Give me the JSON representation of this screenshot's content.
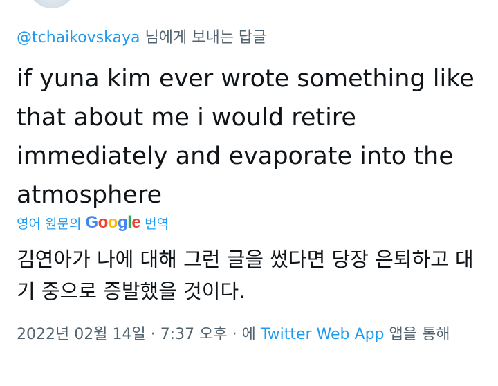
{
  "reply": {
    "handle": "@tchaikovskaya",
    "suffix": "님에게 보내는 답글"
  },
  "tweet": {
    "text": "if yuna kim ever wrote something like that about me i would retire immediately and evaporate into the atmosphere"
  },
  "translation": {
    "prefix": "영어 원문의",
    "logo": [
      "G",
      "o",
      "o",
      "g",
      "l",
      "e"
    ],
    "suffix": "번역",
    "text": "김연아가 나에 대해 그런 글을 썼다면 당장 은퇴하고 대기 중으로 증발했을 것이다."
  },
  "meta": {
    "date": "2022년 02월 14일",
    "sep1": "·",
    "time": "7:37 오후",
    "sep2": "·",
    "via_prefix": "에",
    "source": "Twitter Web App",
    "via_suffix": "앱을 통해"
  }
}
